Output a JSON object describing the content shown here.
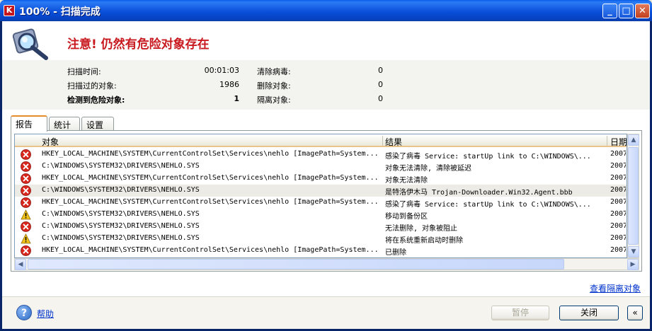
{
  "window": {
    "title": "100% - 扫描完成",
    "app_icon_letter": "K",
    "controls": {
      "minimize": "_",
      "maximize": "□",
      "close": "✕"
    }
  },
  "headline": "注意! 仍然有危险对象存在",
  "stats": {
    "scan_time_label": "扫描时间:",
    "scan_time_value": "00:01:03",
    "scanned_label": "扫描过的对象:",
    "scanned_value": "1986",
    "detected_label": "检测到危险对象:",
    "detected_value": "1",
    "disinfected_label": "清除病毒:",
    "disinfected_value": "0",
    "deleted_label": "删除对象:",
    "deleted_value": "0",
    "quarantined_label": "隔离对象:",
    "quarantined_value": "0"
  },
  "tabs": [
    {
      "label": "报告",
      "active": true
    },
    {
      "label": "统计",
      "active": false
    },
    {
      "label": "设置",
      "active": false
    }
  ],
  "grid": {
    "columns": {
      "object": "对象",
      "result": "结果",
      "date": "日期"
    },
    "rows": [
      {
        "status": "error",
        "object": "HKEY_LOCAL_MACHINE\\SYSTEM\\CurrentControlSet\\Services\\nehlo [ImagePath=System...",
        "result": "感染了病毒 Service: startUp link to C:\\WINDOWS\\...",
        "date": "2007"
      },
      {
        "status": "error",
        "object": "C:\\WINDOWS\\SYSTEM32\\DRIVERS\\NEHLO.SYS",
        "result": "对象无法清除, 清除被延迟",
        "date": "2007"
      },
      {
        "status": "error",
        "object": "HKEY_LOCAL_MACHINE\\SYSTEM\\CurrentControlSet\\Services\\nehlo [ImagePath=System...",
        "result": "对象无法清除",
        "date": "2007"
      },
      {
        "status": "error",
        "object": "C:\\WINDOWS\\SYSTEM32\\DRIVERS\\NEHLO.SYS",
        "result": "是特洛伊木马 Trojan-Downloader.Win32.Agent.bbb",
        "date": "2007",
        "selected": true
      },
      {
        "status": "error",
        "object": "HKEY_LOCAL_MACHINE\\SYSTEM\\CurrentControlSet\\Services\\nehlo [ImagePath=System...",
        "result": "感染了病毒 Service: startUp link to C:\\WINDOWS\\...",
        "date": "2007"
      },
      {
        "status": "warning",
        "object": "C:\\WINDOWS\\SYSTEM32\\DRIVERS\\NEHLO.SYS",
        "result": "移动到备份区",
        "date": "2007"
      },
      {
        "status": "error",
        "object": "C:\\WINDOWS\\SYSTEM32\\DRIVERS\\NEHLO.SYS",
        "result": "无法删除, 对象被阻止",
        "date": "2007"
      },
      {
        "status": "warning",
        "object": "C:\\WINDOWS\\SYSTEM32\\DRIVERS\\NEHLO.SYS",
        "result": "将在系统重新启动时删除",
        "date": "2007"
      },
      {
        "status": "error",
        "object": "HKEY_LOCAL_MACHINE\\SYSTEM\\CurrentControlSet\\Services\\nehlo [ImagePath=System...",
        "result": "已删除",
        "date": "2007"
      }
    ]
  },
  "quarantine_link": "查看隔离对象",
  "footer": {
    "help_icon": "?",
    "help_label": "帮助",
    "pause_label": "暂停",
    "close_label": "关闭",
    "collapse_icon": "«"
  },
  "colors": {
    "headline": "#c8191f",
    "error_icon": "#d8261c",
    "warning_icon": "#f2c21b",
    "link": "#0033cc"
  }
}
